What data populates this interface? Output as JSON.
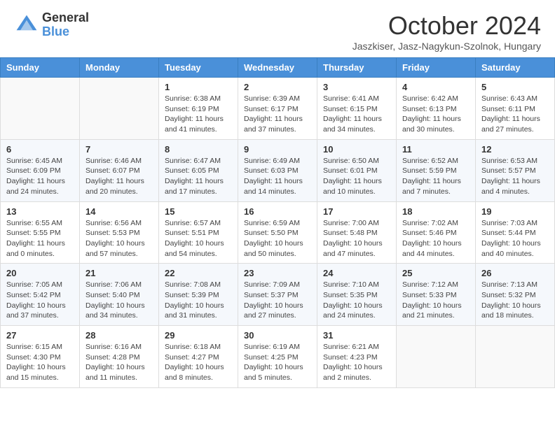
{
  "header": {
    "logo_general": "General",
    "logo_blue": "Blue",
    "month_title": "October 2024",
    "subtitle": "Jaszkiser, Jasz-Nagykun-Szolnok, Hungary"
  },
  "days_of_week": [
    "Sunday",
    "Monday",
    "Tuesday",
    "Wednesday",
    "Thursday",
    "Friday",
    "Saturday"
  ],
  "weeks": [
    [
      {
        "day": "",
        "info": ""
      },
      {
        "day": "",
        "info": ""
      },
      {
        "day": "1",
        "sunrise": "Sunrise: 6:38 AM",
        "sunset": "Sunset: 6:19 PM",
        "daylight": "Daylight: 11 hours and 41 minutes."
      },
      {
        "day": "2",
        "sunrise": "Sunrise: 6:39 AM",
        "sunset": "Sunset: 6:17 PM",
        "daylight": "Daylight: 11 hours and 37 minutes."
      },
      {
        "day": "3",
        "sunrise": "Sunrise: 6:41 AM",
        "sunset": "Sunset: 6:15 PM",
        "daylight": "Daylight: 11 hours and 34 minutes."
      },
      {
        "day": "4",
        "sunrise": "Sunrise: 6:42 AM",
        "sunset": "Sunset: 6:13 PM",
        "daylight": "Daylight: 11 hours and 30 minutes."
      },
      {
        "day": "5",
        "sunrise": "Sunrise: 6:43 AM",
        "sunset": "Sunset: 6:11 PM",
        "daylight": "Daylight: 11 hours and 27 minutes."
      }
    ],
    [
      {
        "day": "6",
        "sunrise": "Sunrise: 6:45 AM",
        "sunset": "Sunset: 6:09 PM",
        "daylight": "Daylight: 11 hours and 24 minutes."
      },
      {
        "day": "7",
        "sunrise": "Sunrise: 6:46 AM",
        "sunset": "Sunset: 6:07 PM",
        "daylight": "Daylight: 11 hours and 20 minutes."
      },
      {
        "day": "8",
        "sunrise": "Sunrise: 6:47 AM",
        "sunset": "Sunset: 6:05 PM",
        "daylight": "Daylight: 11 hours and 17 minutes."
      },
      {
        "day": "9",
        "sunrise": "Sunrise: 6:49 AM",
        "sunset": "Sunset: 6:03 PM",
        "daylight": "Daylight: 11 hours and 14 minutes."
      },
      {
        "day": "10",
        "sunrise": "Sunrise: 6:50 AM",
        "sunset": "Sunset: 6:01 PM",
        "daylight": "Daylight: 11 hours and 10 minutes."
      },
      {
        "day": "11",
        "sunrise": "Sunrise: 6:52 AM",
        "sunset": "Sunset: 5:59 PM",
        "daylight": "Daylight: 11 hours and 7 minutes."
      },
      {
        "day": "12",
        "sunrise": "Sunrise: 6:53 AM",
        "sunset": "Sunset: 5:57 PM",
        "daylight": "Daylight: 11 hours and 4 minutes."
      }
    ],
    [
      {
        "day": "13",
        "sunrise": "Sunrise: 6:55 AM",
        "sunset": "Sunset: 5:55 PM",
        "daylight": "Daylight: 11 hours and 0 minutes."
      },
      {
        "day": "14",
        "sunrise": "Sunrise: 6:56 AM",
        "sunset": "Sunset: 5:53 PM",
        "daylight": "Daylight: 10 hours and 57 minutes."
      },
      {
        "day": "15",
        "sunrise": "Sunrise: 6:57 AM",
        "sunset": "Sunset: 5:51 PM",
        "daylight": "Daylight: 10 hours and 54 minutes."
      },
      {
        "day": "16",
        "sunrise": "Sunrise: 6:59 AM",
        "sunset": "Sunset: 5:50 PM",
        "daylight": "Daylight: 10 hours and 50 minutes."
      },
      {
        "day": "17",
        "sunrise": "Sunrise: 7:00 AM",
        "sunset": "Sunset: 5:48 PM",
        "daylight": "Daylight: 10 hours and 47 minutes."
      },
      {
        "day": "18",
        "sunrise": "Sunrise: 7:02 AM",
        "sunset": "Sunset: 5:46 PM",
        "daylight": "Daylight: 10 hours and 44 minutes."
      },
      {
        "day": "19",
        "sunrise": "Sunrise: 7:03 AM",
        "sunset": "Sunset: 5:44 PM",
        "daylight": "Daylight: 10 hours and 40 minutes."
      }
    ],
    [
      {
        "day": "20",
        "sunrise": "Sunrise: 7:05 AM",
        "sunset": "Sunset: 5:42 PM",
        "daylight": "Daylight: 10 hours and 37 minutes."
      },
      {
        "day": "21",
        "sunrise": "Sunrise: 7:06 AM",
        "sunset": "Sunset: 5:40 PM",
        "daylight": "Daylight: 10 hours and 34 minutes."
      },
      {
        "day": "22",
        "sunrise": "Sunrise: 7:08 AM",
        "sunset": "Sunset: 5:39 PM",
        "daylight": "Daylight: 10 hours and 31 minutes."
      },
      {
        "day": "23",
        "sunrise": "Sunrise: 7:09 AM",
        "sunset": "Sunset: 5:37 PM",
        "daylight": "Daylight: 10 hours and 27 minutes."
      },
      {
        "day": "24",
        "sunrise": "Sunrise: 7:10 AM",
        "sunset": "Sunset: 5:35 PM",
        "daylight": "Daylight: 10 hours and 24 minutes."
      },
      {
        "day": "25",
        "sunrise": "Sunrise: 7:12 AM",
        "sunset": "Sunset: 5:33 PM",
        "daylight": "Daylight: 10 hours and 21 minutes."
      },
      {
        "day": "26",
        "sunrise": "Sunrise: 7:13 AM",
        "sunset": "Sunset: 5:32 PM",
        "daylight": "Daylight: 10 hours and 18 minutes."
      }
    ],
    [
      {
        "day": "27",
        "sunrise": "Sunrise: 6:15 AM",
        "sunset": "Sunset: 4:30 PM",
        "daylight": "Daylight: 10 hours and 15 minutes."
      },
      {
        "day": "28",
        "sunrise": "Sunrise: 6:16 AM",
        "sunset": "Sunset: 4:28 PM",
        "daylight": "Daylight: 10 hours and 11 minutes."
      },
      {
        "day": "29",
        "sunrise": "Sunrise: 6:18 AM",
        "sunset": "Sunset: 4:27 PM",
        "daylight": "Daylight: 10 hours and 8 minutes."
      },
      {
        "day": "30",
        "sunrise": "Sunrise: 6:19 AM",
        "sunset": "Sunset: 4:25 PM",
        "daylight": "Daylight: 10 hours and 5 minutes."
      },
      {
        "day": "31",
        "sunrise": "Sunrise: 6:21 AM",
        "sunset": "Sunset: 4:23 PM",
        "daylight": "Daylight: 10 hours and 2 minutes."
      },
      {
        "day": "",
        "info": ""
      },
      {
        "day": "",
        "info": ""
      }
    ]
  ]
}
